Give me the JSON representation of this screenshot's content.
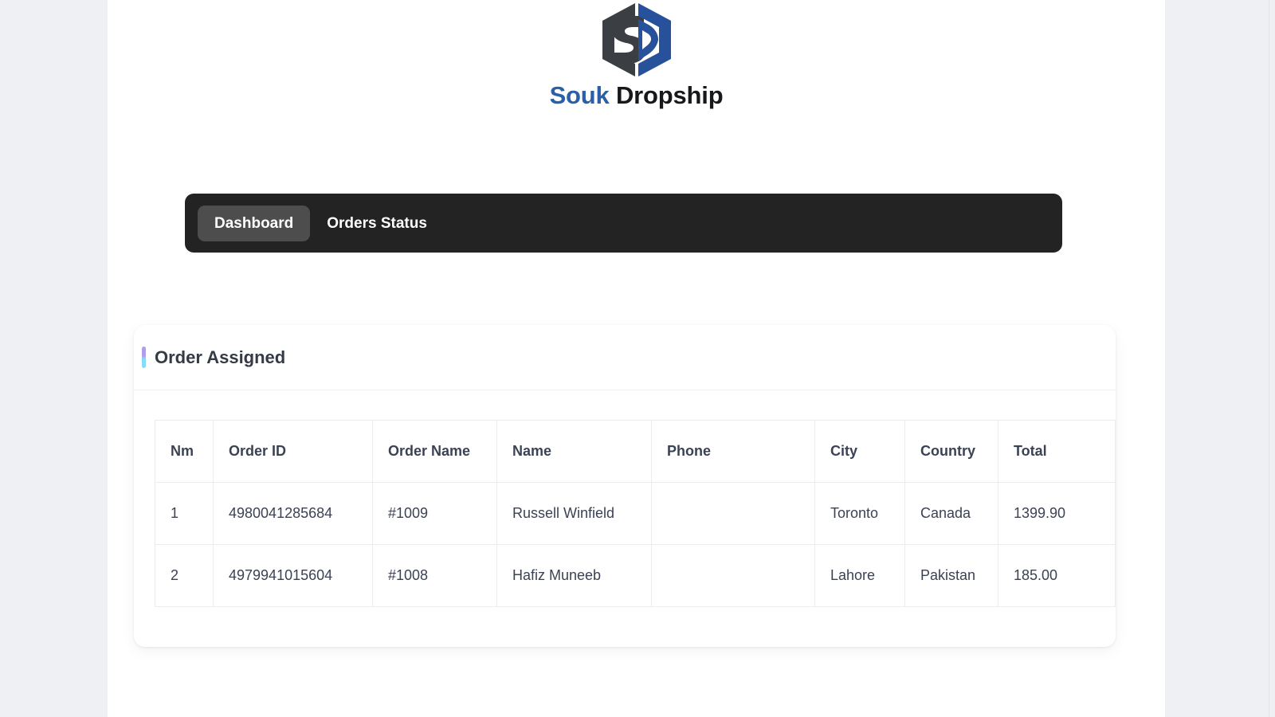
{
  "brand": {
    "logo_icon": "souk-dropship-hexagon-sd-logo",
    "word_1": "Souk",
    "word_2": "Dropship",
    "word_1_color": "#2b5fa8",
    "word_2_color": "#17181c",
    "mark_dark_color": "#3b3f43",
    "mark_blue_color": "#28519c"
  },
  "navbar": {
    "background_color": "#232323",
    "active_pill_color": "#4d4d4d",
    "items": [
      {
        "label": "Dashboard",
        "active": true
      },
      {
        "label": "Orders Status",
        "active": false
      }
    ]
  },
  "section": {
    "title": "Order Assigned",
    "accent_top_color": "#b39ce8",
    "accent_bottom_color": "#85dcf6"
  },
  "table": {
    "columns": [
      "Nm",
      "Order ID",
      "Order Name",
      "Name",
      "Phone",
      "City",
      "Country",
      "Total"
    ],
    "rows": [
      {
        "nm": "1",
        "order_id": "4980041285684",
        "order_name": "#1009",
        "name": "Russell Winfield",
        "phone": "",
        "city": "Toronto",
        "country": "Canada",
        "total": "1399.90"
      },
      {
        "nm": "2",
        "order_id": "4979941015604",
        "order_name": "#1008",
        "name": "Hafiz Muneeb",
        "phone": "",
        "city": "Lahore",
        "country": "Pakistan",
        "total": "185.00"
      }
    ]
  }
}
